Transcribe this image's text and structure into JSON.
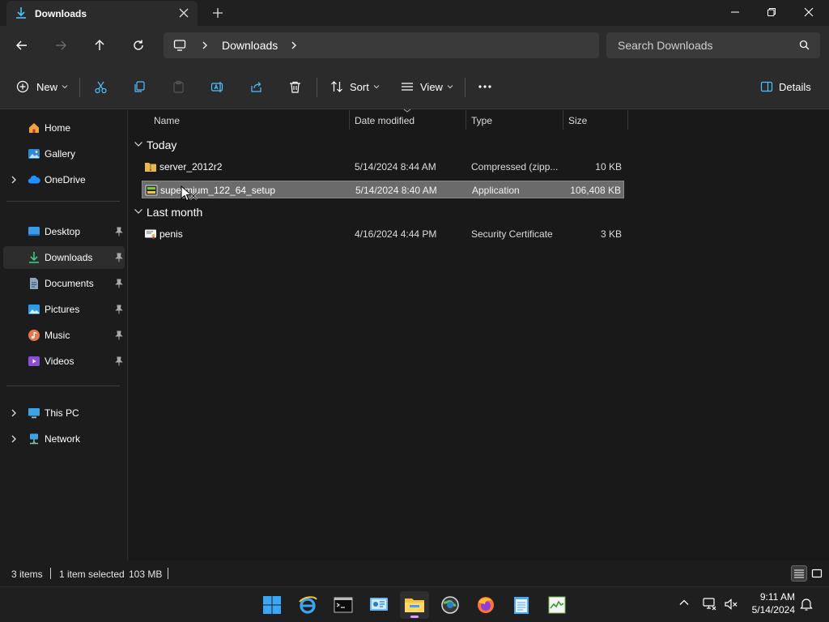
{
  "window": {
    "tab_title": "Downloads",
    "colors": {
      "accent": "#4cc2ff",
      "selected_row": "#6b6b6b",
      "background": "#191919"
    }
  },
  "address": {
    "breadcrumb": "Downloads",
    "search_placeholder": "Search Downloads"
  },
  "commands": {
    "new_label": "New",
    "sort_label": "Sort",
    "view_label": "View",
    "details_label": "Details"
  },
  "sidebar": {
    "top": [
      {
        "label": "Home",
        "icon": "home-icon"
      },
      {
        "label": "Gallery",
        "icon": "gallery-icon"
      },
      {
        "label": "OneDrive",
        "icon": "onedrive-icon"
      }
    ],
    "quick": [
      {
        "label": "Desktop",
        "icon": "desktop-icon"
      },
      {
        "label": "Downloads",
        "icon": "downloads-icon"
      },
      {
        "label": "Documents",
        "icon": "documents-icon"
      },
      {
        "label": "Pictures",
        "icon": "pictures-icon"
      },
      {
        "label": "Music",
        "icon": "music-icon"
      },
      {
        "label": "Videos",
        "icon": "videos-icon"
      }
    ],
    "bottom": [
      {
        "label": "This PC",
        "icon": "this-pc-icon"
      },
      {
        "label": "Network",
        "icon": "network-icon"
      }
    ]
  },
  "columns": {
    "name": "Name",
    "date": "Date modified",
    "type": "Type",
    "size": "Size"
  },
  "groups": [
    {
      "label": "Today",
      "files": [
        {
          "name": "server_2012r2",
          "date": "5/14/2024 8:44 AM",
          "type": "Compressed (zipp...",
          "size": "10 KB",
          "icon": "zip-folder-icon"
        },
        {
          "name": "supermium_122_64_setup",
          "date": "5/14/2024 8:40 AM",
          "type": "Application",
          "size": "106,408 KB",
          "icon": "installer-icon"
        }
      ]
    },
    {
      "label": "Last month",
      "files": [
        {
          "name": "penis",
          "date": "4/16/2024 4:44 PM",
          "type": "Security Certificate",
          "size": "3 KB",
          "icon": "certificate-icon"
        }
      ]
    }
  ],
  "status": {
    "items": "3 items",
    "selected": "1 item selected",
    "selected_size": "103 MB"
  },
  "clock": {
    "time": "9:11 AM",
    "date": "5/14/2024"
  }
}
